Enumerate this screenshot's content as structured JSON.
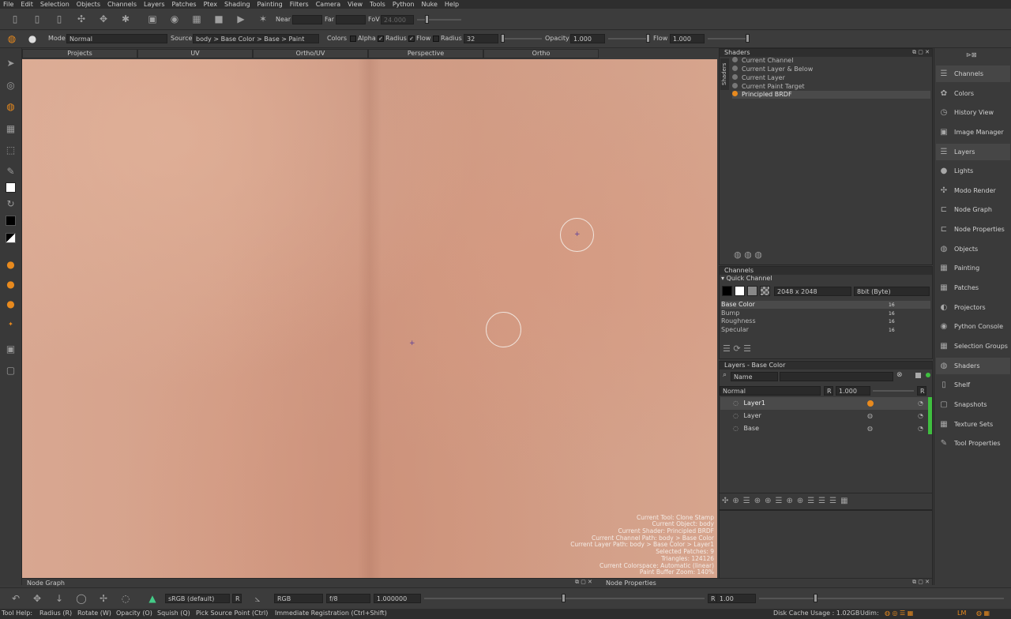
{
  "menu": [
    "File",
    "Edit",
    "Selection",
    "Objects",
    "Channels",
    "Layers",
    "Patches",
    "Ptex",
    "Shading",
    "Painting",
    "Filters",
    "Camera",
    "View",
    "Tools",
    "Python",
    "Nuke",
    "Help"
  ],
  "toolbar1": {
    "near_label": "Near",
    "far_label": "Far",
    "fov_label": "FoV",
    "fov_value": "24.000"
  },
  "toolbar2": {
    "mode_label": "Mode",
    "mode_value": "Normal",
    "source_label": "Source",
    "source_value": "body > Base Color > Base > Paint",
    "colors_label": "Colors",
    "alpha_label": "Alpha",
    "radius_cb_label": "Radius",
    "flow_cb_label": "Flow",
    "radius_label": "Radius",
    "radius_value": "32",
    "opacity_label": "Opacity",
    "opacity_value": "1.000",
    "flow_label": "Flow",
    "flow_value": "1.000"
  },
  "view_tabs": [
    "Projects",
    "UV",
    "Ortho/UV",
    "Perspective",
    "Ortho"
  ],
  "viewport_info": [
    "Current Tool: Clone Stamp",
    "Current Object: body",
    "Current Shader: Principled BRDF",
    "Current Channel Path: body > Base Color",
    "Current Layer Path: body > Base Color > Layer1",
    "Selected Patches: 9",
    "Triangles: 124126",
    "Current Colorspace: Automatic (linear)",
    "Paint Buffer Zoom: 140%"
  ],
  "shaders": {
    "title": "Shaders",
    "side_tab": "Shaders",
    "items": [
      "Current Channel",
      "Current Layer & Below",
      "Current Layer",
      "Current Paint Target",
      "Principled BRDF"
    ]
  },
  "channels": {
    "title": "Channels",
    "quick_channel": "Quick Channel",
    "size": "2048 x 2048",
    "depth": "8bit  (Byte)",
    "list": [
      "Base Color",
      "Bump",
      "Roughness",
      "Specular"
    ],
    "bit": "16"
  },
  "layers": {
    "title": "Layers - Base Color",
    "search_placeholder": "Name",
    "blend_mode": "Normal",
    "r_label": "R",
    "opacity": "1.000",
    "items": [
      "Layer1",
      "Layer",
      "Base"
    ]
  },
  "right_panel": [
    "Channels",
    "Colors",
    "History View",
    "Image Manager",
    "Layers",
    "Lights",
    "Modo Render",
    "Node Graph",
    "Node Properties",
    "Objects",
    "Painting",
    "Patches",
    "Projectors",
    "Python Console",
    "Selection Groups",
    "Shaders",
    "Shelf",
    "Snapshots",
    "Texture Sets",
    "Tool Properties"
  ],
  "bottom_panels": {
    "node_graph": "Node Graph",
    "node_properties": "Node Properties"
  },
  "bottom_toolbar": {
    "colorspace": "sRGB (default)",
    "r_label": "R",
    "channel_mode": "RGB",
    "fstop": "f/8",
    "gain": "1.000000",
    "r2_label": "R",
    "gamma": "1.00"
  },
  "status": {
    "tool_help": "Tool Help:",
    "radius_hint": "Radius (R)",
    "rotate_hint": "Rotate (W)",
    "opacity_hint": "Opacity (O)",
    "squish_hint": "Squish (Q)",
    "pick_hint": "Pick Source Point (Ctrl)",
    "immediate_hint": "Immediate Registration (Ctrl+Shift)",
    "disk_cache": "Disk Cache Usage : 1.02GB",
    "udim": "Udim:",
    "lm": "LM"
  }
}
